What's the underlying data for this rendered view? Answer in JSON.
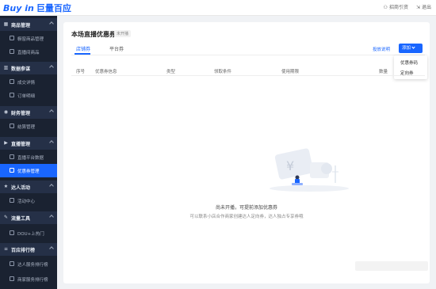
{
  "app": {
    "logo_text": "Buy in",
    "logo_brand": "巨量百应"
  },
  "topbar": {
    "link1": "招商引资",
    "link2": "退出"
  },
  "sidebar": {
    "groups": [
      {
        "label": "商品管理",
        "icon": "grid-icon",
        "items": [
          "橱窗商品管理",
          "直播间商品"
        ]
      },
      {
        "label": "数据参谋",
        "icon": "chart-icon",
        "items": [
          "成交详情",
          "订单明细"
        ]
      },
      {
        "label": "财务管理",
        "icon": "finance-icon",
        "items": [
          "结算管理"
        ]
      },
      {
        "label": "直播管理",
        "icon": "live-icon",
        "items": [
          "直播平台数据",
          "优惠券管理"
        ]
      },
      {
        "label": "达人活动",
        "icon": "star-icon",
        "items": [
          "活动中心"
        ]
      },
      {
        "label": "流量工具",
        "icon": "tool-icon",
        "items": [
          "DOU+上热门"
        ]
      },
      {
        "label": "百应排行榜",
        "icon": "rank-icon",
        "items": [
          "达人服务排行榜",
          "商家服务排行榜"
        ]
      }
    ],
    "active_item": "优惠券管理"
  },
  "main": {
    "title": "本场直播优惠券",
    "badge": "未开播",
    "tabs": [
      {
        "label": "店铺券",
        "active": true
      },
      {
        "label": "平台券",
        "active": false
      }
    ],
    "help_link": "投放说明",
    "add_button": "添加",
    "dropdown": [
      "优惠券码",
      "定向券"
    ],
    "columns": [
      "序号",
      "优惠券信息",
      "类型",
      "领取条件",
      "使用期限",
      "数量"
    ],
    "empty_title": "尚未开播，可提前添加优惠券",
    "empty_sub": "可以联系小店合作商家创建达人定向券，达人独占专享券哦"
  },
  "colors": {
    "accent": "#1966ff",
    "sidebar_bg": "#1a2231",
    "sidebar_group_bg": "#253047"
  }
}
